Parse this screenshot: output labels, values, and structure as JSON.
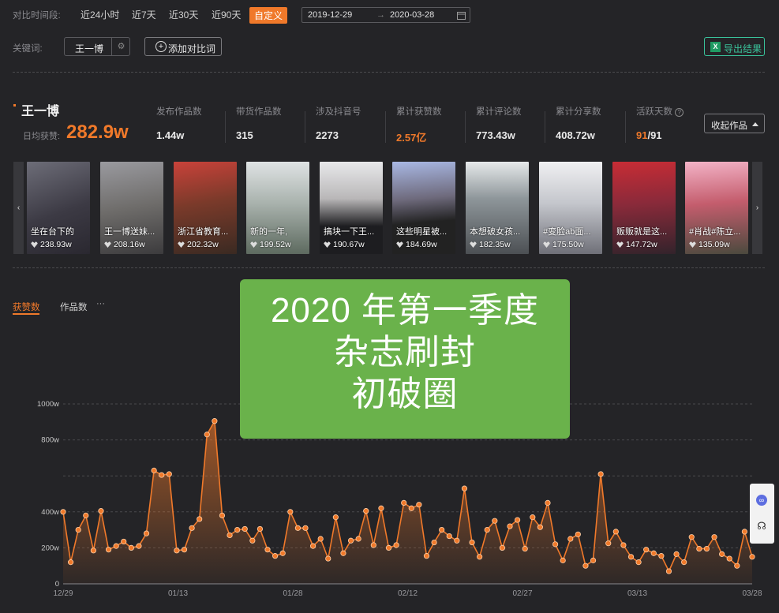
{
  "filters": {
    "period_label": "对比时间段:",
    "options": [
      "近24小时",
      "近7天",
      "近30天",
      "近90天",
      "自定义"
    ],
    "active": "自定义",
    "date_start": "2019-12-29",
    "date_end": "2020-03-28",
    "keyword_label": "关键词:",
    "keyword_value": "王一博",
    "add_compare_label": "添加对比词",
    "export_label": "导出结果"
  },
  "profile": {
    "name": "王一博",
    "daily_likes_label": "日均获赞:",
    "daily_likes_value": "282.9w"
  },
  "stats": [
    {
      "label": "发布作品数",
      "value": "1.44w"
    },
    {
      "label": "带货作品数",
      "value": "315"
    },
    {
      "label": "涉及抖音号",
      "value": "2273"
    },
    {
      "label": "累计获赞数",
      "value": "2.57亿"
    },
    {
      "label": "累计评论数",
      "value": "773.43w"
    },
    {
      "label": "累计分享数",
      "value": "408.72w"
    }
  ],
  "active_days": {
    "label": "活跃天数",
    "value_hi": "91",
    "value_rest": "/91"
  },
  "collapse_label": "收起作品",
  "videos": [
    {
      "caption": "坐在台下的",
      "likes": "238.93w"
    },
    {
      "caption": "王一博送妹...",
      "likes": "208.16w"
    },
    {
      "caption": "浙江省教育...",
      "likes": "202.32w"
    },
    {
      "caption": "新的一年,",
      "likes": "199.52w"
    },
    {
      "caption": "搞块一下王...",
      "likes": "190.67w"
    },
    {
      "caption": "这些明星被...",
      "likes": "184.69w"
    },
    {
      "caption": "本想破女孩...",
      "likes": "182.35w"
    },
    {
      "caption": "#变脸ab面...",
      "likes": "175.50w"
    },
    {
      "caption": "贩贩就是这...",
      "likes": "147.72w"
    },
    {
      "caption": "#肖战#陈立...",
      "likes": "135.09w"
    }
  ],
  "tabs": {
    "likes": "获赞数",
    "works": "作品数",
    "more": "···"
  },
  "overlay": {
    "line1": "2020 年第一季度",
    "line2": "杂志刷封",
    "line3": "初破圈"
  },
  "colors": {
    "accent": "#f0792a",
    "overlay": "#6ab24b",
    "export": "#3ac29a"
  },
  "chart_data": {
    "type": "line",
    "title": "",
    "xlabel": "",
    "ylabel": "",
    "x_tick_labels": [
      "12/29",
      "01/13",
      "01/28",
      "02/12",
      "02/27",
      "03/13",
      "03/28"
    ],
    "y_tick_labels": [
      "0",
      "200w",
      "400w",
      "",
      "800w",
      "1000w"
    ],
    "ylim": [
      0,
      1000
    ],
    "grid": true,
    "series": [
      {
        "values": [
          400,
          120,
          300,
          380,
          185,
          405,
          190,
          210,
          235,
          200,
          210,
          280,
          630,
          605,
          610,
          185,
          190,
          310,
          360,
          830,
          905,
          380,
          270,
          300,
          305,
          240,
          305,
          190,
          155,
          170,
          400,
          310,
          310,
          210,
          250,
          140,
          370,
          170,
          240,
          250,
          405,
          215,
          420,
          200,
          215,
          450,
          420,
          440,
          155,
          230,
          300,
          265,
          240,
          530,
          230,
          150,
          300,
          350,
          200,
          320,
          355,
          195,
          370,
          315,
          450,
          220,
          130,
          250,
          275,
          100,
          130,
          610,
          225,
          290,
          215,
          150,
          120,
          190,
          170,
          155,
          70,
          165,
          120,
          260,
          195,
          195,
          260,
          165,
          140,
          100,
          290,
          150
        ]
      }
    ]
  }
}
